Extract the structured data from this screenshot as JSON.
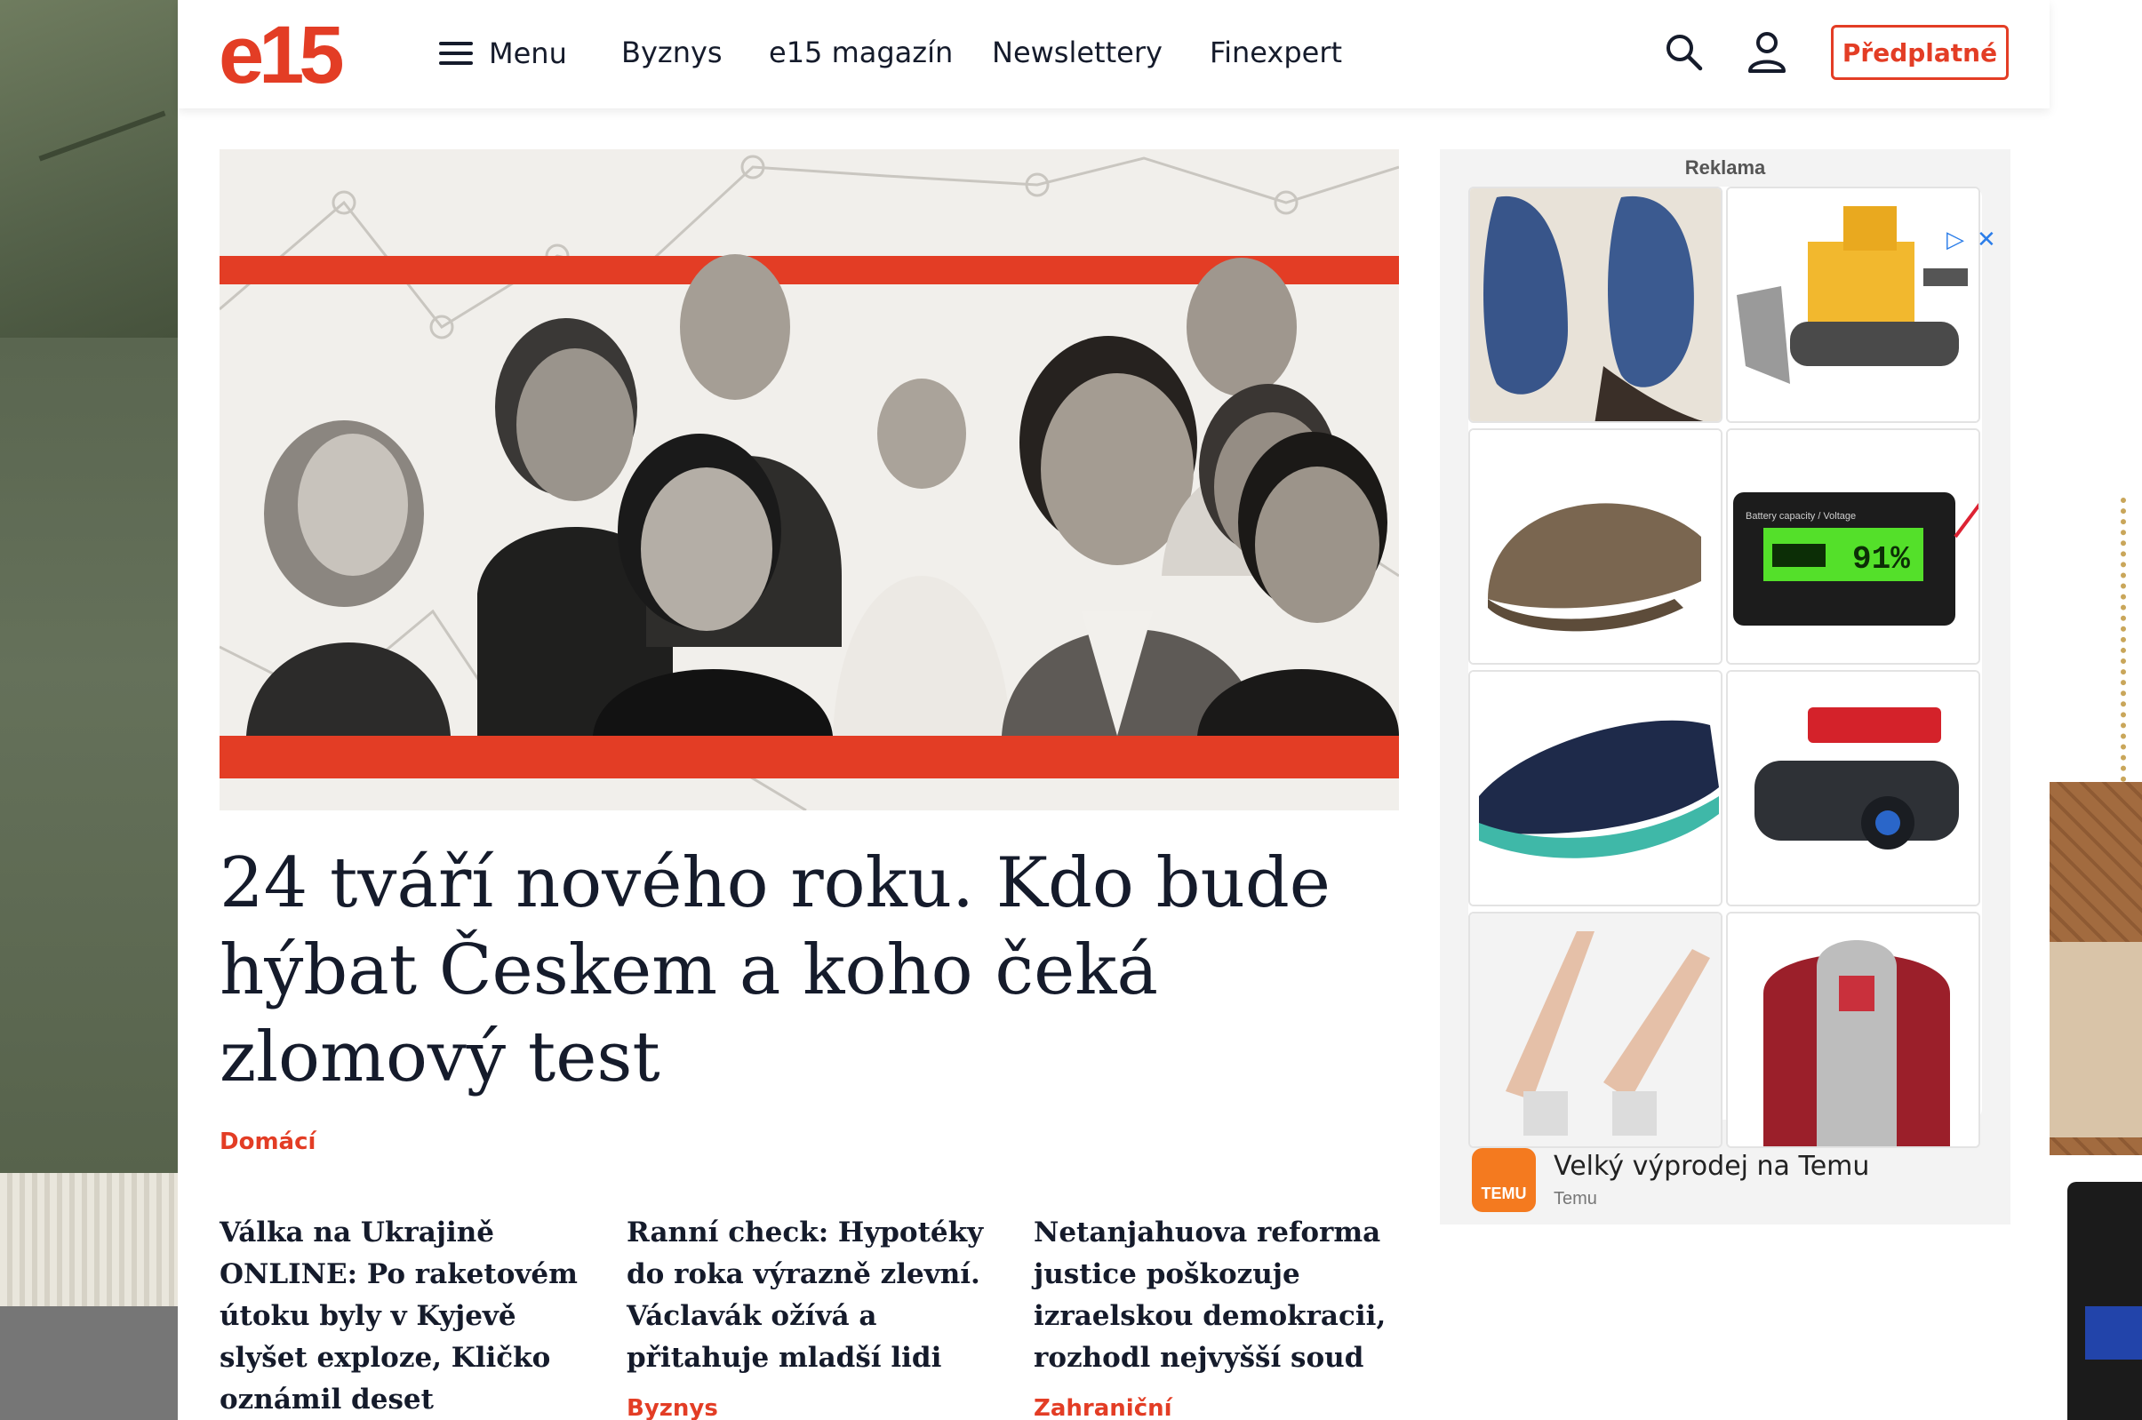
{
  "header": {
    "logo": "e15",
    "menu_label": "Menu",
    "nav": [
      "Byznys",
      "e15 magazín",
      "Newslettery",
      "Finexpert"
    ],
    "subscribe_label": "Předplatné"
  },
  "hero": {
    "title": "24 tváří nového roku. Kdo bude hýbat Českem a koho čeká zlomový test",
    "category": "Domácí"
  },
  "articles": [
    {
      "title": "Válka na Ukrajině ONLINE: Po raketovém útoku byly v Kyjevě slyšet exploze, Kličko oznámil deset zraněných",
      "category": ""
    },
    {
      "title": "Ranní check: Hypotéky do roka výrazně zlevní. Václavák ožívá a přitahuje mladší lidi",
      "category": "Byznys"
    },
    {
      "title": "Netanjahuova reforma justice poškozuje izraelskou demokracii, rozhodl nejvyšší soud",
      "category": "Zahraniční"
    }
  ],
  "ad": {
    "label": "Reklama",
    "brand_logo": "TEMU",
    "headline": "Velký výprodej na Temu",
    "source": "Temu",
    "battery_caption": "Battery capacity / Voltage",
    "battery_value": "91%",
    "items": [
      "sneakers-icon",
      "bulldozer-toy-icon",
      "flat-cap-icon",
      "battery-meter-icon",
      "barefoot-shoe-icon",
      "dashcam-icon",
      "high-heels-icon",
      "hoodie-icon"
    ]
  },
  "colors": {
    "brand": "#e33d25",
    "text": "#151b2b",
    "ad_accent": "#f47a1f"
  }
}
